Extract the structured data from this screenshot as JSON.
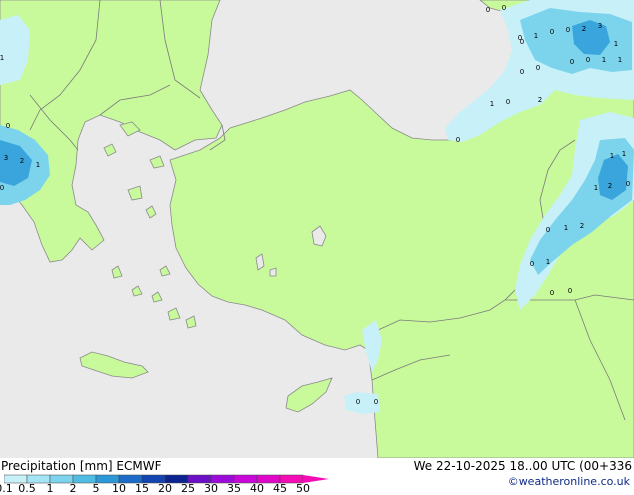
{
  "product": "Precipitation [mm]",
  "model": "ECMWF",
  "valid_time": "We 22-10-2025 18..00 UTC (00+336",
  "credit": "©weatheronline.co.uk",
  "legend": {
    "ticks": [
      "0.1",
      "0.5",
      "1",
      "2",
      "5",
      "10",
      "15",
      "20",
      "25",
      "30",
      "35",
      "40",
      "45",
      "50"
    ],
    "colors": [
      "#c8f0f8",
      "#a4e4f4",
      "#7cd4ec",
      "#50bce4",
      "#2c98d8",
      "#1c6cc8",
      "#1444b0",
      "#0c2490",
      "#6c10c8",
      "#9c0cd8",
      "#c808d8",
      "#e008c8",
      "#f40cb4"
    ]
  },
  "colors": {
    "land": "#c8fa9c",
    "sea": "#eaeaea",
    "coast": "#8a8a8a",
    "border": "#7a7a7a",
    "precip_light": "#c8f0f8",
    "precip_mid": "#7cd4ec",
    "precip_heavy": "#3aa4dc"
  },
  "precip_values": [
    "0",
    "0",
    "0",
    "1",
    "0",
    "0",
    "2",
    "3",
    "1",
    "1",
    "0",
    "0",
    "1",
    "0",
    "0",
    "0",
    "2",
    "1",
    "3",
    "2",
    "1",
    "0",
    "1",
    "1",
    "1",
    "0",
    "2",
    "1",
    "2",
    "0",
    "1",
    "1",
    "0",
    "0",
    "0",
    "0",
    "0",
    "0",
    "0",
    "0"
  ]
}
